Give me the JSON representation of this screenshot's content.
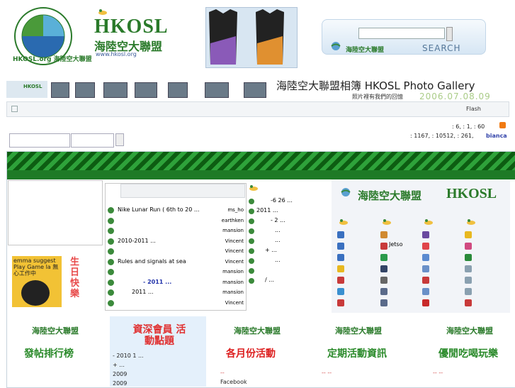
{
  "header": {
    "brand_name": "HKOSL",
    "brand_cn": "海陸空大聯盟",
    "brand_url": "www.hkosl.org",
    "logo_ring_text": "HKOSL.org 海陸空大聯盟"
  },
  "search": {
    "logo_text": "海陸空大聯盟",
    "label": "SEARCH",
    "placeholder": ""
  },
  "gallery": {
    "title": "海陸空大聯盟相簿 HKOSL Photo Gallery",
    "subtitle": "照片裡有我們的回憶",
    "date": "2006.07.08.09"
  },
  "navbar": {
    "flash": "Flash"
  },
  "stats": {
    "line1": ": 6,   : 1,    : 60",
    "line2": ": 1167,  : 10512,  : 261,",
    "user": "bianca"
  },
  "poster": {
    "text": "emma suggest Play Game la 無心工作中",
    "bday": "生日快樂"
  },
  "topics": [
    {
      "title": "Nike Lunar Run ( 6th to 20 ...",
      "user": "ms_ho"
    },
    {
      "title": "",
      "user": "earthken"
    },
    {
      "title": "",
      "user": "mansion"
    },
    {
      "title": "2010-2011         ...",
      "user": "Vincent"
    },
    {
      "title": "",
      "user": "Vincent"
    },
    {
      "title": "Rules and signals at sea",
      "user": "Vincent"
    },
    {
      "title": "",
      "user": "mansion"
    },
    {
      "title": "- 2011     ...",
      "user": "mansion"
    },
    {
      "title": "2011     ...",
      "user": "mansion"
    },
    {
      "title": "",
      "user": "Vincent"
    }
  ],
  "news": [
    {
      "text": "-6 26 ...",
      "indent": 20
    },
    {
      "text": "2011      ...",
      "indent": 0
    },
    {
      "text": "- 2 ...",
      "indent": 20
    },
    {
      "text": "...",
      "indent": 26
    },
    {
      "text": "...",
      "indent": 26
    },
    {
      "text": "+       ...",
      "indent": 12
    },
    {
      "text": "...",
      "indent": 26
    },
    {
      "text": "",
      "indent": 0
    },
    {
      "text": "/    ...",
      "indent": 12
    }
  ],
  "right_panel": {
    "logo": "海陸空大聯盟",
    "brand": "HKOSL",
    "jetso": "Jetso"
  },
  "bottom": [
    {
      "logo": "海陸空大聯盟",
      "title": "發帖排行榜",
      "lines": [
        "",
        ""
      ]
    },
    {
      "logo": "",
      "title": "資深會員 活動點題",
      "lines": [
        "- 2010 1 ...",
        "+      ...",
        "2009",
        "2009"
      ]
    },
    {
      "logo": "海陸空大聯盟",
      "title": "各月份活動",
      "lines": [
        "--",
        "Facebook"
      ]
    },
    {
      "logo": "海陸空大聯盟",
      "title": "定期活動資訊",
      "lines": [
        "-- --",
        ""
      ]
    },
    {
      "logo": "海陸空大聯盟",
      "title": "優閒吃喝玩樂",
      "lines": [
        "-- --",
        ""
      ]
    }
  ],
  "colors": {
    "brand_green": "#2a7a2a",
    "banner_dark": "#0d5d12",
    "accent_red": "#e84a4a"
  }
}
